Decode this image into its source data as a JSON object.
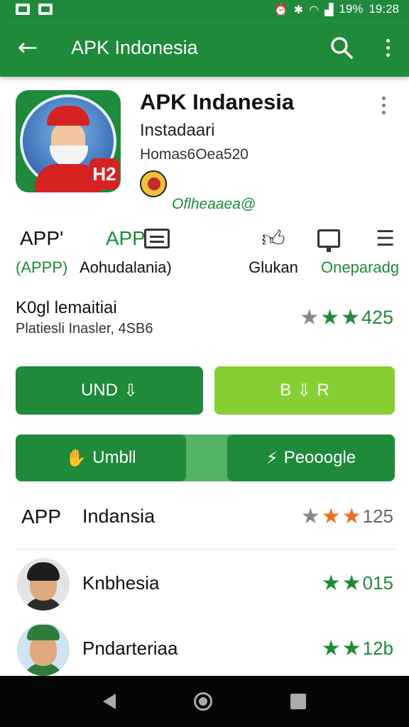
{
  "status_bar": {
    "battery": "19%",
    "time": "19:28"
  },
  "app_bar": {
    "title": "APK Indonesia"
  },
  "app": {
    "name": "APK Indanesia",
    "developer": "Instadaari",
    "meta": "Homas6Oea520",
    "icon_badge": "H2",
    "developer_label": "Oflheaaea@"
  },
  "info_strip": [
    {
      "top": "APP'",
      "bottom": "(APPP)"
    },
    {
      "top": "APP",
      "bottom": "Aohudalania)"
    },
    {
      "icon": "list-box-icon",
      "bottom": ""
    },
    {
      "icon": "thumb-icon",
      "bottom": "Glukan"
    },
    {
      "icon": "monitor-icon",
      "bottom": ""
    },
    {
      "icon": "checklist-icon",
      "bottom": "Oneparadg"
    }
  ],
  "rating": {
    "title": "K0gl lemaitiai",
    "subtitle": "Platiesli Inasler, 4SB6",
    "value": "425"
  },
  "buttons": {
    "install": "UND",
    "buy": "B",
    "buy_suffix": "R",
    "umbl": "Umbll",
    "peoogle": "Peooogle"
  },
  "list_header": {
    "app": "APP",
    "title": "Indansia",
    "rating": "125"
  },
  "list": [
    {
      "name": "Knbhesia",
      "rating": "015"
    },
    {
      "name": "Pndarteriaa",
      "rating": "12b"
    }
  ],
  "colors": {
    "primary": "#1e8a3a",
    "lime": "#86cf33",
    "star_orange": "#ef6c1e"
  }
}
